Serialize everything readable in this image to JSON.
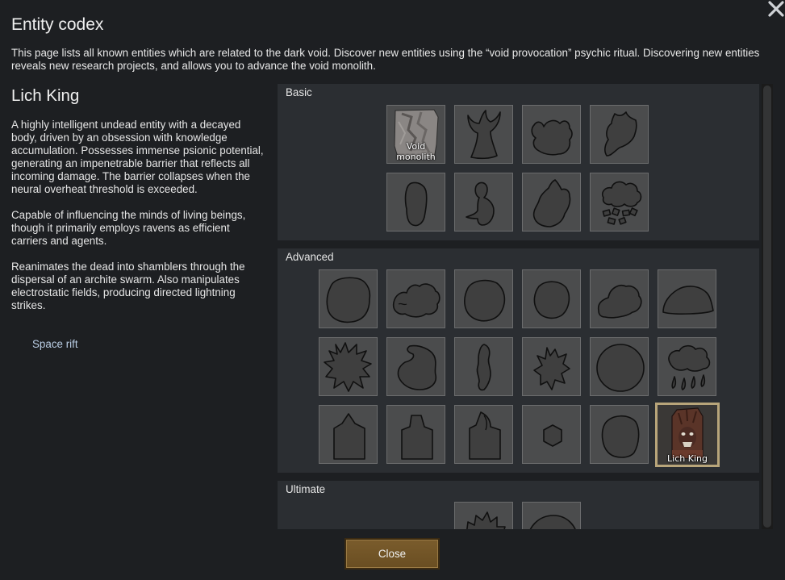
{
  "window": {
    "title": "Entity codex",
    "close_icon": "close-x-icon",
    "intro": "This page lists all known entities which are related to the dark void. Discover new entities using the “void provocation” psychic ritual. Discovering new entities reveals new research projects, and allows you to advance the void monolith."
  },
  "selected": {
    "name": "Lich King",
    "paragraphs": [
      "A highly intelligent undead entity with a decayed body, driven by an obsession with knowledge accumulation. Possesses immense psionic potential, generating an impenetrable barrier that reflects all incoming damage. The barrier collapses when the neural overheat threshold is exceeded.",
      "Capable of influencing the minds of living beings, though it primarily employs ravens as efficient carriers and agents.",
      "Reanimates the dead into shamblers through the dispersal of an archite swarm. Also manipulates electrostatic fields, producing directed lightning strikes."
    ],
    "link": "Space rift"
  },
  "sections": {
    "basic": {
      "label": "Basic",
      "tiles": [
        {
          "icon": "void-monolith-icon",
          "label": "Void monolith"
        },
        {
          "icon": "unknown-horned-entity-icon"
        },
        {
          "icon": "unknown-creature-icon"
        },
        {
          "icon": "unknown-flame-entity-icon"
        },
        {
          "icon": "unknown-blob-icon"
        },
        {
          "icon": "unknown-bird-icon"
        },
        {
          "icon": "unknown-beast-icon"
        },
        {
          "icon": "unknown-cloud-icon"
        }
      ]
    },
    "advanced": {
      "label": "Advanced",
      "tiles": [
        {
          "icon": "unknown-flesh-mass-icon"
        },
        {
          "icon": "unknown-swarm-icon"
        },
        {
          "icon": "unknown-round-blob-icon"
        },
        {
          "icon": "unknown-orb-icon"
        },
        {
          "icon": "unknown-lump-icon"
        },
        {
          "icon": "unknown-mound-icon"
        },
        {
          "icon": "unknown-spiky-icon"
        },
        {
          "icon": "unknown-serpent-icon"
        },
        {
          "icon": "unknown-wisp-icon"
        },
        {
          "icon": "unknown-spiky-creature-icon"
        },
        {
          "icon": "unknown-sphere-icon"
        },
        {
          "icon": "unknown-rain-cloud-icon"
        },
        {
          "icon": "unknown-tower-icon"
        },
        {
          "icon": "unknown-tower-2-icon"
        },
        {
          "icon": "unknown-tower-3-icon"
        },
        {
          "icon": "unknown-hexagon-icon"
        },
        {
          "icon": "unknown-egg-icon"
        },
        {
          "icon": "lich-king-icon",
          "label": "Lich King",
          "selected": true
        }
      ]
    },
    "ultimate": {
      "label": "Ultimate",
      "tiles": [
        {
          "icon": "unknown-spiky-ultimate-icon"
        },
        {
          "icon": "unknown-dome-icon"
        }
      ]
    }
  },
  "footer": {
    "close_label": "Close"
  }
}
